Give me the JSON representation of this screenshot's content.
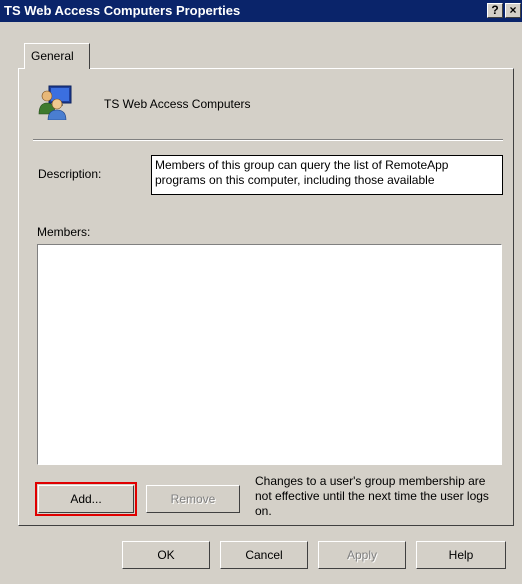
{
  "window": {
    "title": "TS Web Access Computers Properties",
    "help_glyph": "?",
    "close_glyph": "×"
  },
  "tabs": [
    {
      "label": "General",
      "selected": true
    }
  ],
  "general": {
    "group_name": "TS Web Access Computers",
    "group_icon": "users-group-icon",
    "description_label": "Description:",
    "description_value": "Members of this group can query the list of RemoteApp programs on this computer, including those available",
    "members_label": "Members:",
    "members": [],
    "add_label": "Add...",
    "remove_label": "Remove",
    "note": "Changes to a user's group membership are not effective until the next time the user logs on."
  },
  "footer": {
    "ok_label": "OK",
    "cancel_label": "Cancel",
    "apply_label": "Apply",
    "help_label": "Help"
  },
  "colors": {
    "titlebar": "#0a246a",
    "face": "#d4d0c8",
    "highlight": "#e00000"
  }
}
